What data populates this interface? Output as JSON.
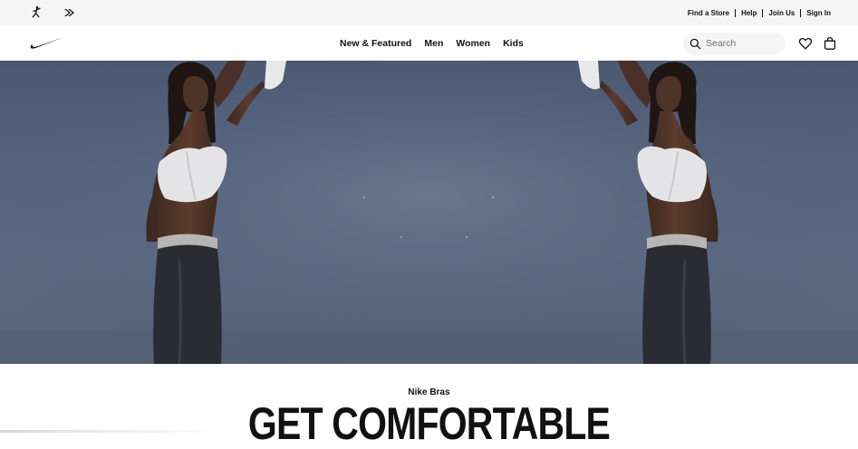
{
  "utility_bar": {
    "brand_icons": [
      "jordan-icon",
      "converse-icon"
    ],
    "links": [
      "Find a Store",
      "Help",
      "Join Us",
      "Sign In"
    ]
  },
  "main_nav": {
    "logo": "nike-swoosh-icon",
    "menu": [
      "New & Featured",
      "Men",
      "Women",
      "Kids"
    ],
    "search": {
      "placeholder": "Search",
      "value": ""
    },
    "icons": [
      "search-icon",
      "heart-icon",
      "bag-icon"
    ]
  },
  "hero": {
    "image": "mirrored photo of a dancer in a white sports bra and dark skirt against a blue-gray backdrop"
  },
  "promo": {
    "eyebrow": "Nike Bras",
    "headline": "GET COMFORTABLE"
  },
  "colors": {
    "utility_bg": "#f5f5f5",
    "text": "#111111",
    "muted": "#707072",
    "hero_bg": "#56647e"
  }
}
